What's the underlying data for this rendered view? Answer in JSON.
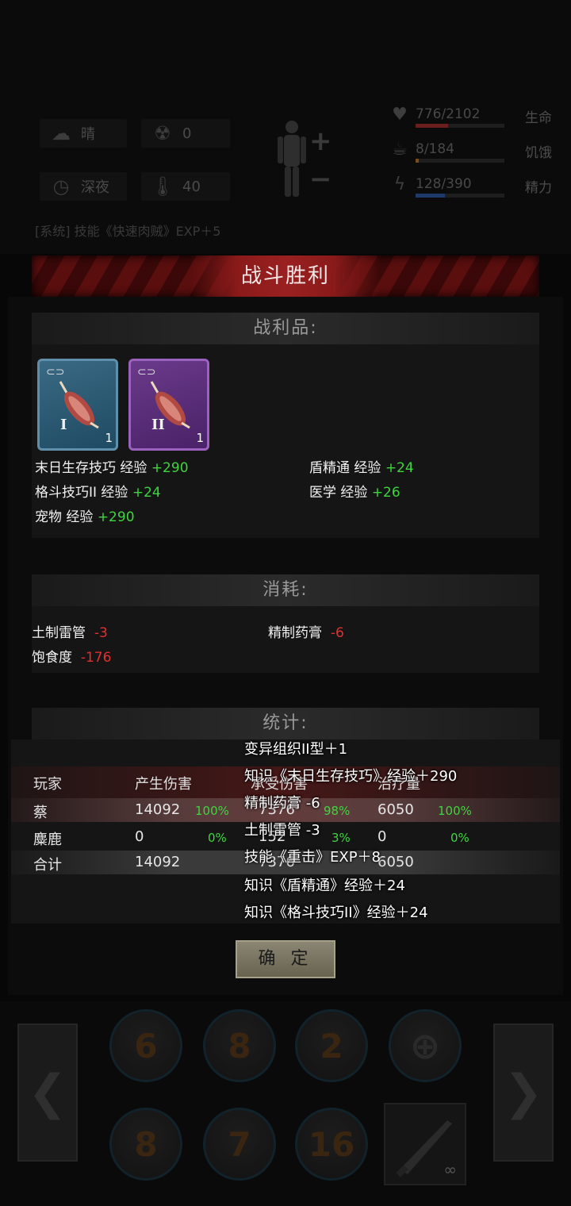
{
  "hud": {
    "weather": "晴",
    "radiation": "0",
    "time_of_day": "深夜",
    "temperature": "40",
    "vitals": [
      {
        "label": "生命",
        "value": "776/2102",
        "fraction": 0.37,
        "color": "#6a1e1e",
        "icon": "heart-icon"
      },
      {
        "label": "饥饿",
        "value": "8/184",
        "fraction": 0.04,
        "color": "#7a4a1a",
        "icon": "stomach-icon"
      },
      {
        "label": "精力",
        "value": "128/390",
        "fraction": 0.33,
        "color": "#1e3a6a",
        "icon": "energy-icon"
      }
    ],
    "system_log": "[系统] 技能《快速肉贼》EXP＋5"
  },
  "dialog": {
    "title": "战斗胜利",
    "loot_heading": "战利品:",
    "loot_items": [
      {
        "tier": "I",
        "qty": "1",
        "rarity": "blue",
        "icon": "meat-icon"
      },
      {
        "tier": "II",
        "qty": "1",
        "rarity": "purple",
        "icon": "meat-icon"
      }
    ],
    "xp_gains": [
      {
        "name": "末日生存技巧 经验",
        "amount": "+290"
      },
      {
        "name": "盾精通 经验",
        "amount": "+24"
      },
      {
        "name": "格斗技巧II 经验",
        "amount": "+24"
      },
      {
        "name": "医学 经验",
        "amount": "+26"
      },
      {
        "name": "宠物 经验",
        "amount": "+290"
      }
    ],
    "consume_heading": "消耗:",
    "consumptions": [
      {
        "name": "土制雷管",
        "amount": "-3"
      },
      {
        "name": "精制药膏",
        "amount": "-6"
      },
      {
        "name": "饱食度",
        "amount": "-176"
      }
    ],
    "stats_heading": "统计:",
    "stats_headers": [
      "玩家",
      "产生伤害",
      "承受伤害",
      "治疗量"
    ],
    "stats_rows": [
      {
        "player": "蔡",
        "damage": "14092",
        "damage_pct": "100%",
        "taken": "7376",
        "taken_pct": "98%",
        "heal": "6050",
        "heal_pct": "100%"
      },
      {
        "player": "麋鹿",
        "damage": "0",
        "damage_pct": "0%",
        "taken": "152",
        "taken_pct": "3%",
        "heal": "0",
        "heal_pct": "0%"
      }
    ],
    "stats_total": {
      "label": "合计",
      "damage": "14092",
      "taken": "7376",
      "heal": "6050"
    },
    "overlay_messages": [
      "变异组织II型＋1",
      "知识《末日生存技巧》经验＋290",
      "精制药膏 -6",
      "土制雷管 -3",
      "技能《重击》EXP＋8",
      "知识《盾精通》经验＋24",
      "知识《格斗技巧II》经验＋24"
    ],
    "confirm_label": "确 定"
  },
  "skill_bar": {
    "left_arrow": "❮",
    "right_arrow": "❯",
    "skills": [
      "6",
      "8",
      "2",
      "",
      "8",
      "7",
      "16"
    ],
    "weapon_ammo": "∞"
  }
}
